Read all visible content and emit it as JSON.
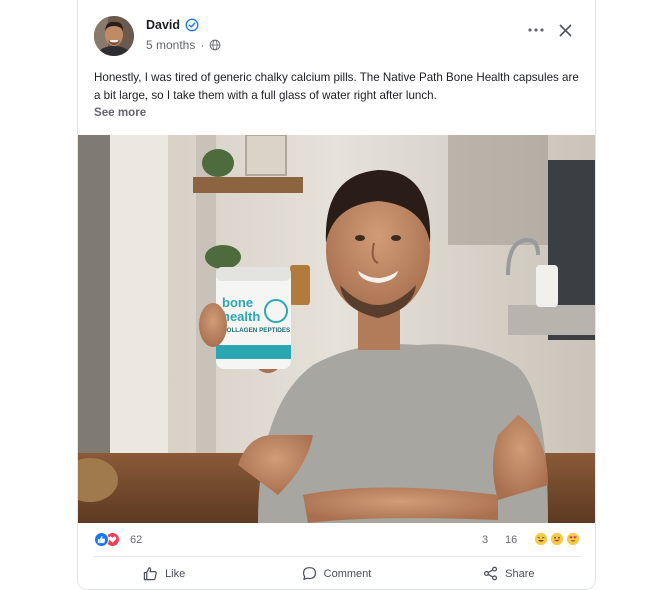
{
  "post": {
    "author": {
      "name": "David",
      "verified": true
    },
    "time_ago": "5 months",
    "separator": "·",
    "privacy_icon": "globe-icon",
    "text": "Honestly, I was tired of generic chalky calcium pills. The Native Path Bone Health capsules are a bit large, so I take them with a full glass of water right after lunch.",
    "see_more_label": "See more",
    "photo": {
      "product_label": {
        "line1": "bone",
        "line2": "health",
        "line3": "COLLAGEN PEPTIDES"
      }
    }
  },
  "stats": {
    "reaction_icons": [
      "like-icon",
      "love-icon"
    ],
    "reaction_count": "62",
    "comment_count": "3",
    "share_count": "16",
    "emoji_icons": [
      "laugh-emoji-icon",
      "grin-emoji-icon",
      "heart-eyes-emoji-icon"
    ]
  },
  "actions": {
    "like_label": "Like",
    "comment_label": "Comment",
    "share_label": "Share"
  },
  "colors": {
    "verified_blue": "#1877f2",
    "like_blue": "#1877f2",
    "love_red": "#f33e58",
    "text_primary": "#1c1e21",
    "text_secondary": "#65676b",
    "product_teal": "#2aa7b3"
  }
}
